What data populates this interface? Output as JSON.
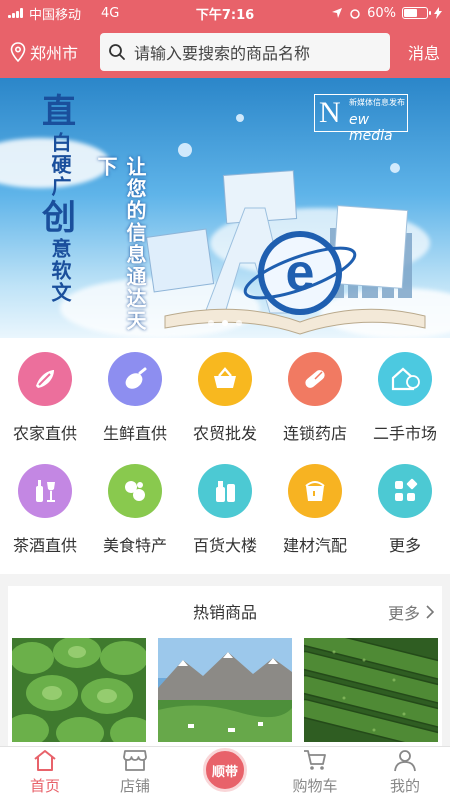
{
  "status_bar": {
    "carrier": "中国移动",
    "network": "4G",
    "time": "下午7:16",
    "battery": "60%",
    "battery_level": 0.6
  },
  "header": {
    "city": "郑州市",
    "search_placeholder": "请输入要搜索的商品名称",
    "message_label": "消息"
  },
  "banner": {
    "badge_letter": "N",
    "badge_text": "ew media",
    "badge_small": "新媒体信息发布",
    "slogan_left": [
      "直",
      "白硬广",
      "创",
      "意软文"
    ],
    "slogan_right": "让您的信息通达天下",
    "slide_count": 3,
    "active_slide": 1
  },
  "categories": [
    {
      "label": "农家直供",
      "color": "#ec6f9c",
      "icon": "farmer-icon"
    },
    {
      "label": "生鲜直供",
      "color": "#8d8ef0",
      "icon": "eggplant-icon"
    },
    {
      "label": "农贸批发",
      "color": "#f8b81f",
      "icon": "basket-icon"
    },
    {
      "label": "连锁药店",
      "color": "#f17a62",
      "icon": "pill-icon"
    },
    {
      "label": "二手市场",
      "color": "#4cc9e0",
      "icon": "house-icon"
    },
    {
      "label": "茶酒直供",
      "color": "#c387e3",
      "icon": "wine-icon"
    },
    {
      "label": "美食特产",
      "color": "#89c94e",
      "icon": "food-icon"
    },
    {
      "label": "百货大楼",
      "color": "#4cc9d3",
      "icon": "bottles-icon"
    },
    {
      "label": "建材汽配",
      "color": "#f7b322",
      "icon": "paint-bucket-icon"
    },
    {
      "label": "更多",
      "color": "#4cc9d3",
      "icon": "grid-icon"
    }
  ],
  "hot": {
    "title": "热销商品",
    "more_label": "更多",
    "products": [
      "lettuce-image",
      "mountain-image",
      "cucumber-image"
    ]
  },
  "tabbar": [
    {
      "label": "首页",
      "icon": "home-icon",
      "active": true
    },
    {
      "label": "店铺",
      "icon": "shop-icon",
      "active": false
    },
    {
      "label": "顺带",
      "icon": "center-badge",
      "active": false
    },
    {
      "label": "购物车",
      "icon": "cart-icon",
      "active": false
    },
    {
      "label": "我的",
      "icon": "user-icon",
      "active": false
    }
  ],
  "colors": {
    "brand": "#e8626a",
    "tab_active": "#e8626a"
  }
}
